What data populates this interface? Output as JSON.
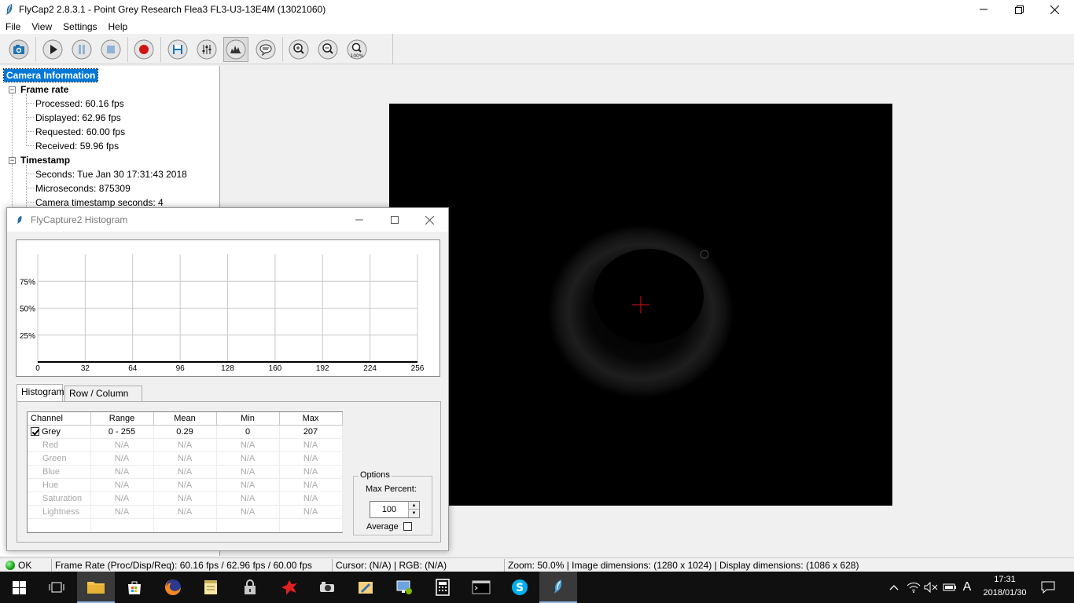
{
  "window": {
    "title": "FlyCap2 2.8.3.1 - Point Grey Research Flea3 FL3-U3-13E4M (13021060)"
  },
  "menu": [
    "File",
    "View",
    "Settings",
    "Help"
  ],
  "toolbar": {
    "buttons": [
      "camera-select",
      "start",
      "pause",
      "stop",
      "record",
      "save",
      "camera-control",
      "histogram",
      "event-stats",
      "zoom-in",
      "zoom-out",
      "zoom-100"
    ],
    "zoom_100_label": "100%"
  },
  "tree": {
    "root": "Camera Information",
    "groups": [
      {
        "label": "Frame rate",
        "items": [
          "Processed: 60.16 fps",
          "Displayed: 62.96 fps",
          "Requested: 60.00 fps",
          "Received: 59.96 fps"
        ]
      },
      {
        "label": "Timestamp",
        "items": [
          "Seconds: Tue Jan 30 17:31:43 2018",
          "Microseconds: 875309",
          "Camera timestamp seconds: 4"
        ]
      }
    ]
  },
  "histogram": {
    "title": "FlyCapture2 Histogram",
    "chart_data": {
      "type": "line",
      "x_ticks": [
        0,
        32,
        64,
        96,
        128,
        160,
        192,
        224,
        256
      ],
      "y_ticks": [
        "25%",
        "50%",
        "75%"
      ],
      "xlim": [
        0,
        256
      ],
      "ylim": [
        0,
        100
      ],
      "grid": true,
      "series": [
        {
          "x": [
            0,
            256
          ],
          "values": [
            0,
            0
          ]
        }
      ]
    },
    "tabs": [
      "Histogram",
      "Row / Column Plot"
    ],
    "table": {
      "headers": [
        "Channel",
        "Range",
        "Mean",
        "Min",
        "Max"
      ],
      "rows": [
        {
          "channel": "Grey",
          "range": "0 - 255",
          "mean": "0.29",
          "min": "0",
          "max": "207",
          "enabled": true,
          "checked": true
        },
        {
          "channel": "Red",
          "range": "N/A",
          "mean": "N/A",
          "min": "N/A",
          "max": "N/A",
          "enabled": false
        },
        {
          "channel": "Green",
          "range": "N/A",
          "mean": "N/A",
          "min": "N/A",
          "max": "N/A",
          "enabled": false
        },
        {
          "channel": "Blue",
          "range": "N/A",
          "mean": "N/A",
          "min": "N/A",
          "max": "N/A",
          "enabled": false
        },
        {
          "channel": "Hue",
          "range": "N/A",
          "mean": "N/A",
          "min": "N/A",
          "max": "N/A",
          "enabled": false
        },
        {
          "channel": "Saturation",
          "range": "N/A",
          "mean": "N/A",
          "min": "N/A",
          "max": "N/A",
          "enabled": false
        },
        {
          "channel": "Lightness",
          "range": "N/A",
          "mean": "N/A",
          "min": "N/A",
          "max": "N/A",
          "enabled": false
        }
      ]
    },
    "options": {
      "legend": "Options",
      "max_percent_label": "Max Percent:",
      "max_percent_value": "100",
      "average_label": "Average",
      "average_checked": false
    }
  },
  "statusbar": {
    "ok": "OK",
    "frame_rate": "Frame Rate (Proc/Disp/Req): 60.16 fps / 62.96 fps / 60.00 fps",
    "cursor": "Cursor: (N/A) | RGB: (N/A)",
    "zoom": "Zoom: 50.0% | Image dimensions: (1280 x 1024) | Display dimensions: (1086 x 628)"
  },
  "taskbar": {
    "ime": "A",
    "time": "17:31",
    "date": "2018/01/30"
  },
  "colors": {
    "accent": "#0078d7",
    "crosshair": "#e01010",
    "ok": "#16a316"
  }
}
